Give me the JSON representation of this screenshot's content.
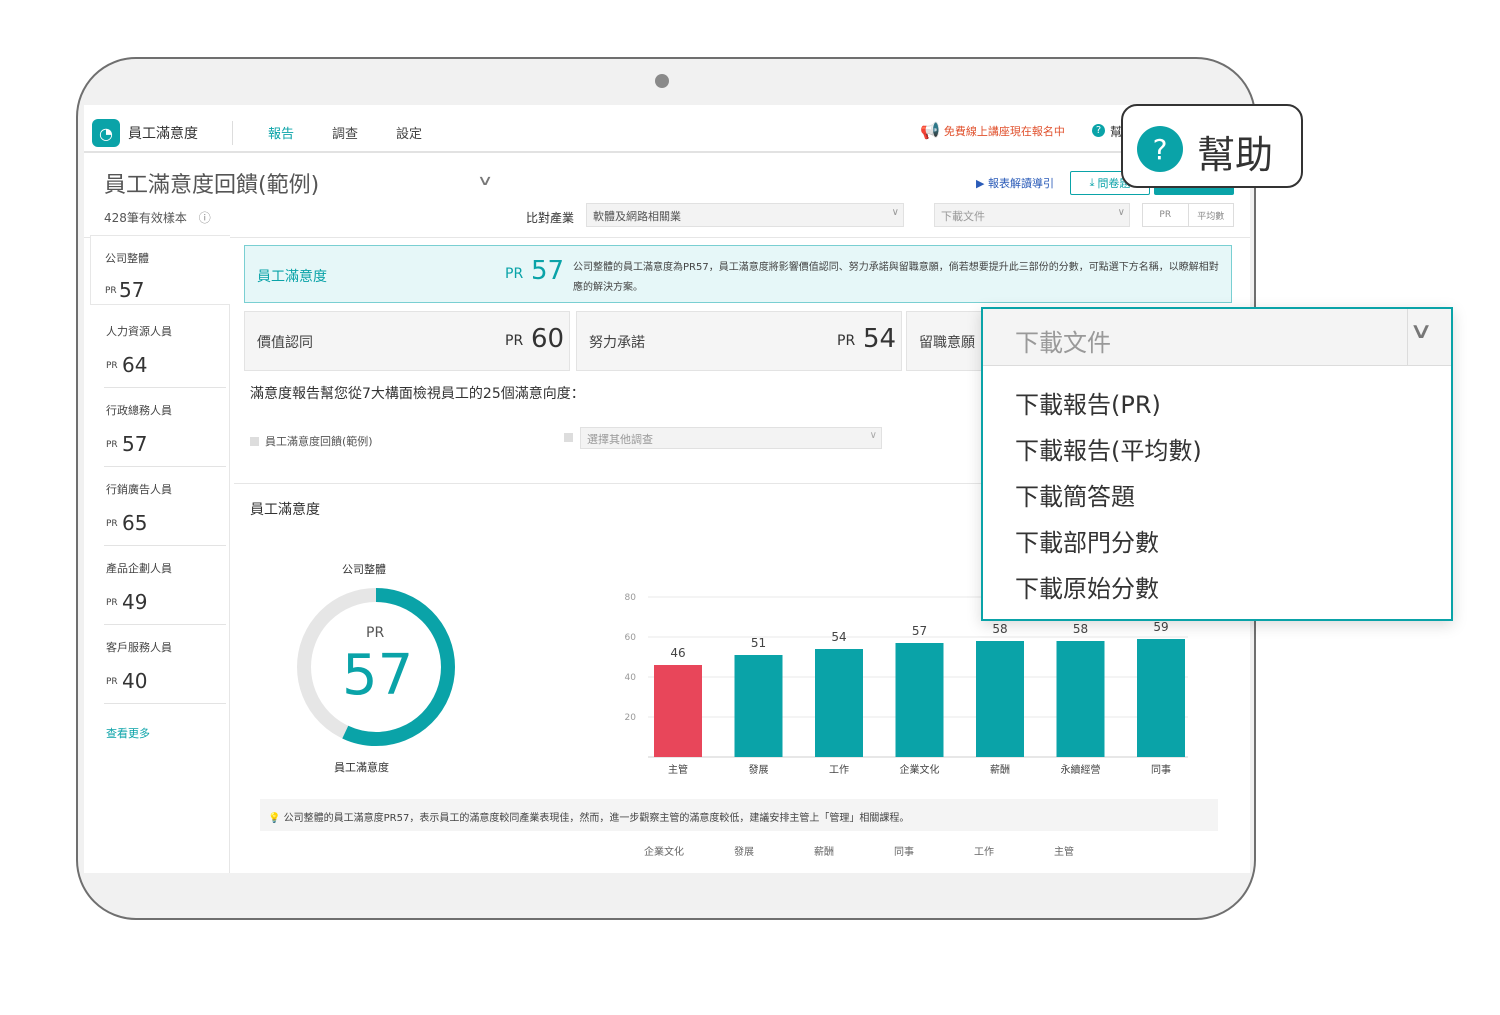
{
  "nav": {
    "app_title": "員工滿意度",
    "items": [
      "報告",
      "調查",
      "設定"
    ],
    "promo": "免費線上講座現在報名中",
    "help_label": "幫"
  },
  "report": {
    "title": "員工滿意度回饋(範例)",
    "sample_count": "428筆有效樣本",
    "guide_link": "報表解讀導引",
    "survey_button": "問卷題",
    "compare_label": "比對產業",
    "compare_value": "軟體及網路相關業",
    "download_placeholder": "下載文件",
    "toggle": [
      "PR",
      "平均數"
    ]
  },
  "sidebar": {
    "items": [
      {
        "name": "公司整體",
        "pr_label": "PR",
        "pr": "57"
      },
      {
        "name": "人力資源人員",
        "pr_label": "PR",
        "pr": "64"
      },
      {
        "name": "行政總務人員",
        "pr_label": "PR",
        "pr": "57"
      },
      {
        "name": "行銷廣告人員",
        "pr_label": "PR",
        "pr": "65"
      },
      {
        "name": "產品企劃人員",
        "pr_label": "PR",
        "pr": "49"
      },
      {
        "name": "客戶服務人員",
        "pr_label": "PR",
        "pr": "40"
      }
    ],
    "more": "查看更多"
  },
  "summary": {
    "label": "員工滿意度",
    "pr_label": "PR",
    "pr": "57",
    "desc": "公司整體的員工滿意度為PR57，員工滿意度將影響價值認同、努力承諾與留職意願，倘若想要提升此三部份的分數，可點選下方名稱，以瞭解相對應的解決方案。"
  },
  "subcards": [
    {
      "label": "價值認同",
      "pr_label": "PR",
      "pr": "60"
    },
    {
      "label": "努力承諾",
      "pr_label": "PR",
      "pr": "54"
    },
    {
      "label": "留職意願",
      "pr_label": "",
      "pr": ""
    }
  ],
  "intro": "滿意度報告幫您從7大構面檢視員工的25個滿意向度：",
  "checks": {
    "current": "員工滿意度回饋(範例)",
    "other_placeholder": "選擇其他調查"
  },
  "section_title": "員工滿意度",
  "gauge": {
    "top_label": "公司整體",
    "pr_label": "PR",
    "value": "57",
    "bottom_label": "員工滿意度",
    "fraction": 0.57
  },
  "chart_data": {
    "type": "bar",
    "categories": [
      "主管",
      "發展",
      "工作",
      "企業文化",
      "薪酬",
      "永續經營",
      "同事"
    ],
    "values": [
      46,
      51,
      54,
      57,
      58,
      58,
      59
    ],
    "ylim": [
      0,
      80
    ],
    "yticks": [
      20,
      40,
      60,
      80
    ],
    "grid": true,
    "highlight_color": "#e8465a",
    "bar_color": "#0aa3a8"
  },
  "insight": "公司整體的員工滿意度PR57，表示員工的滿意度較同產業表現佳，然而，進一步觀察主管的滿意度較低，建議安排主管上「管理」相關課程。",
  "cut_row": [
    "企業文化",
    "發展",
    "薪酬",
    "同事",
    "工作",
    "主管"
  ],
  "dropdown": {
    "placeholder": "下載文件",
    "options": [
      "下載報告(PR)",
      "下載報告(平均數)",
      "下載簡答題",
      "下載部門分數",
      "下載原始分數"
    ]
  },
  "help_callout": {
    "icon": "?",
    "label": "幫助"
  },
  "colors": {
    "accent": "#0aa3a8",
    "warning": "#e0502c"
  }
}
